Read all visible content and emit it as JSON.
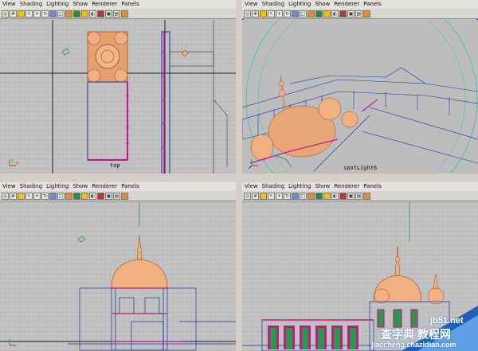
{
  "menu_items": [
    "View",
    "Shading",
    "Lighting",
    "Show",
    "Renderer",
    "Panels"
  ],
  "toolbar_icons": [
    "camera-icon",
    "grid-icon",
    "light-icon",
    "select-icon",
    "move-icon",
    "rotate-icon",
    "scale-icon",
    "wireframe-icon",
    "shaded-icon",
    "textured-icon",
    "bulb-icon",
    "shadow-icon",
    "isolate-icon",
    "xray-icon",
    "frame-icon",
    "render-icon"
  ],
  "viewports": {
    "top": {
      "label": "top"
    },
    "perspective": {
      "label": "spotLight6"
    },
    "front": {
      "label": ""
    },
    "side": {
      "label": ""
    }
  },
  "watermark": {
    "line1": "jb51.net",
    "line2": "查字典 教程网",
    "line3": "jiaocheng.chazidian.com"
  },
  "colors": {
    "grid_bg": "#c2c2c2",
    "model_orange": "#f0b080",
    "model_blue": "#1c2fa8",
    "model_magenta": "#c4178e",
    "active_border": "#3a63d1"
  }
}
